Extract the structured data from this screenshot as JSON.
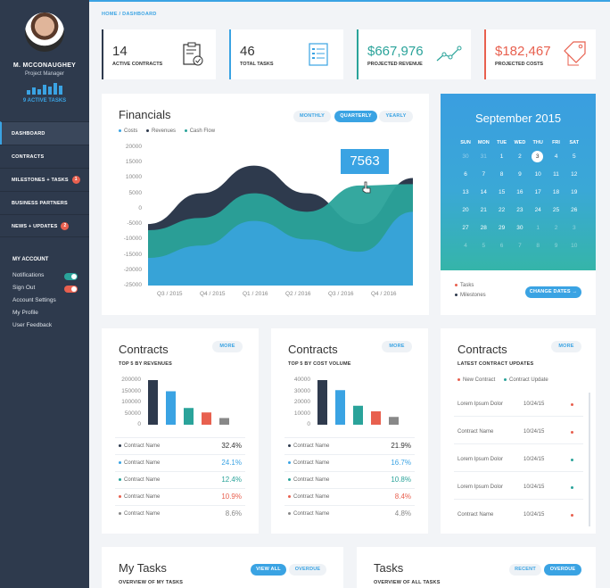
{
  "user": {
    "name": "M. MCCONAUGHEY",
    "role": "Project Manager",
    "tasks_label": "9 ACTIVE TASKS"
  },
  "nav": [
    {
      "label": "DASHBOARD"
    },
    {
      "label": "CONTRACTS"
    },
    {
      "label": "MILESTONES + TASKS",
      "badge": "1"
    },
    {
      "label": "BUSINESS PARTNERS"
    },
    {
      "label": "NEWS + UPDATES",
      "badge": "2"
    }
  ],
  "account": {
    "title": "MY ACCOUNT",
    "items": [
      "Notifications",
      "Sign Out",
      "Account Settings",
      "My Profile",
      "User Feedback"
    ]
  },
  "breadcrumb": "HOME / DASHBOARD",
  "stats": [
    {
      "value": "14",
      "label": "ACTIVE CONTRACTS",
      "color": "#2e3a4d"
    },
    {
      "value": "46",
      "label": "TOTAL TASKS",
      "color": "#3aa3e3"
    },
    {
      "value": "$667,976",
      "label": "PROJECTED REVENUE",
      "color": "#2aa39a"
    },
    {
      "value": "$182,467",
      "label": "PROJECTED COSTS",
      "color": "#e8604f"
    }
  ],
  "financials": {
    "title": "Financials",
    "tabs": [
      "MONTHLY",
      "QUARTERLY",
      "YEARLY"
    ],
    "legend": [
      "Costs",
      "Revenues",
      "Cash Flow"
    ],
    "tooltip": "7563",
    "yticks": [
      "20000",
      "15000",
      "10000",
      "5000",
      "0",
      "-5000",
      "-10000",
      "-15000",
      "-20000",
      "-25000"
    ],
    "xticks": [
      "Q3 / 2015",
      "Q4 / 2015",
      "Q1 / 2016",
      "Q2 / 2016",
      "Q3 / 2016",
      "Q4 / 2016"
    ]
  },
  "calendar": {
    "title": "September 2015",
    "days": [
      "SUN",
      "MON",
      "TUE",
      "WED",
      "THU",
      "FRI",
      "SAT"
    ],
    "weeks": [
      [
        "30",
        "31",
        "1",
        "2",
        "3",
        "4",
        "5"
      ],
      [
        "6",
        "7",
        "8",
        "9",
        "10",
        "11",
        "12"
      ],
      [
        "13",
        "14",
        "15",
        "16",
        "17",
        "18",
        "19"
      ],
      [
        "20",
        "21",
        "22",
        "23",
        "24",
        "25",
        "26"
      ],
      [
        "27",
        "28",
        "29",
        "30",
        "1",
        "2",
        "3"
      ],
      [
        "4",
        "5",
        "6",
        "7",
        "8",
        "9",
        "10"
      ]
    ],
    "legend": [
      "Tasks",
      "Milestones"
    ],
    "button": "CHANGE DATES →"
  },
  "contracts_revenue": {
    "title": "Contracts",
    "more": "MORE",
    "subtitle": "TOP 5 BY REVENUES",
    "yticks": [
      "200000",
      "150000",
      "100000",
      "50000",
      "0"
    ],
    "rows": [
      {
        "name": "Contract Name",
        "value": "32.4%",
        "color": "#2e3a4d"
      },
      {
        "name": "Contract Name",
        "value": "24.1%",
        "color": "#3aa3e3"
      },
      {
        "name": "Contract Name",
        "value": "12.4%",
        "color": "#2aa39a"
      },
      {
        "name": "Contract Name",
        "value": "10.9%",
        "color": "#e8604f"
      },
      {
        "name": "Contract Name",
        "value": "8.6%",
        "color": "#888888"
      }
    ]
  },
  "contracts_volume": {
    "title": "Contracts",
    "more": "MORE",
    "subtitle": "TOP 5 BY COST VOLUME",
    "yticks": [
      "40000",
      "30000",
      "20000",
      "10000",
      "0"
    ],
    "rows": [
      {
        "name": "Contract Name",
        "value": "21.9%",
        "color": "#2e3a4d"
      },
      {
        "name": "Contract Name",
        "value": "16.7%",
        "color": "#3aa3e3"
      },
      {
        "name": "Contract Name",
        "value": "10.8%",
        "color": "#2aa39a"
      },
      {
        "name": "Contract Name",
        "value": "8.4%",
        "color": "#e8604f"
      },
      {
        "name": "Contract Name",
        "value": "4.8%",
        "color": "#888888"
      }
    ]
  },
  "contracts_updates": {
    "title": "Contracts",
    "more": "MORE",
    "subtitle": "LATEST CONTRACT UPDATES",
    "legend": [
      "New Contract",
      "Contract Update"
    ],
    "rows": [
      {
        "name": "Lorem Ipsum Dolor",
        "date": "10/24/15",
        "color": "#e8604f"
      },
      {
        "name": "Contract Name",
        "date": "10/24/15",
        "color": "#e8604f"
      },
      {
        "name": "Lorem Ipsum Dolor",
        "date": "10/24/15",
        "color": "#2aa39a"
      },
      {
        "name": "Lorem Ipsum Dolor",
        "date": "10/24/15",
        "color": "#2aa39a"
      },
      {
        "name": "Contract Name",
        "date": "10/24/15",
        "color": "#e8604f"
      }
    ]
  },
  "my_tasks": {
    "title": "My Tasks",
    "subtitle": "OVERVIEW OF MY TASKS",
    "btn_all": "VIEW ALL",
    "btn_overdue": "OVERDUE"
  },
  "tasks": {
    "title": "Tasks",
    "subtitle": "OVERVIEW OF ALL TASKS",
    "btn_recent": "RECENT",
    "btn_overdue": "OVERDUE"
  },
  "chart_data": [
    {
      "type": "area",
      "title": "Financials",
      "x": [
        "Q3 / 2015",
        "Q4 / 2015",
        "Q1 / 2016",
        "Q2 / 2016",
        "Q3 / 2016",
        "Q4 / 2016"
      ],
      "ylim": [
        -25000,
        20000
      ],
      "series": [
        {
          "name": "Costs",
          "values": [
            -25000,
            -25000,
            -25000,
            -25000,
            -25000,
            -25000
          ]
        },
        {
          "name": "Revenues",
          "values": [
            -5000,
            5000,
            14000,
            5000,
            -5000,
            10000
          ]
        },
        {
          "name": "Cash Flow",
          "values": [
            -7000,
            -3000,
            5000,
            -1000,
            7563,
            8000
          ]
        }
      ]
    },
    {
      "type": "bar",
      "title": "Contracts",
      "categories": [
        "Contract Name",
        "Contract Name",
        "Contract Name",
        "Contract Name",
        "Contract Name"
      ],
      "values": [
        200000,
        150000,
        75000,
        55000,
        30000
      ],
      "ylim": [
        0,
        200000
      ]
    },
    {
      "type": "bar",
      "title": "Contracts",
      "categories": [
        "Contract Name",
        "Contract Name",
        "Contract Name",
        "Contract Name",
        "Contract Name"
      ],
      "values": [
        40000,
        31000,
        17000,
        12000,
        7000
      ],
      "ylim": [
        0,
        40000
      ]
    }
  ]
}
